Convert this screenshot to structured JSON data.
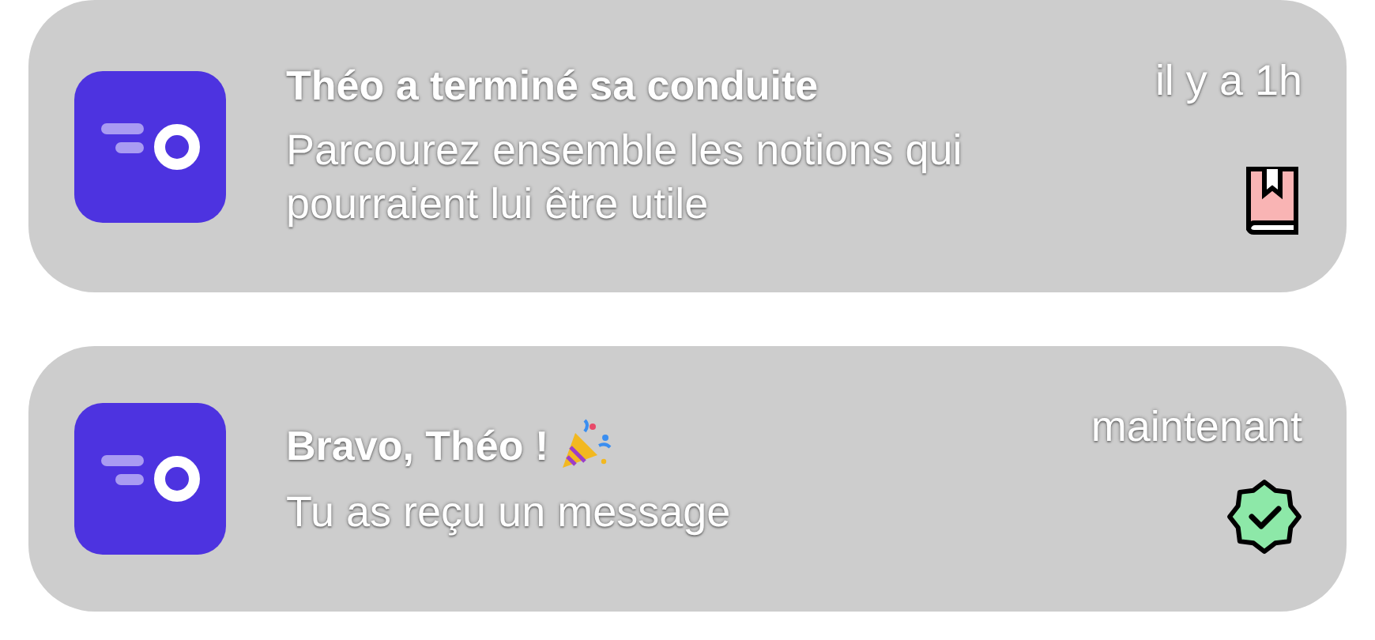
{
  "notifications": [
    {
      "title": "Théo a terminé sa conduite",
      "party_icon": false,
      "time": "il y a 1h",
      "body": "Parcourez ensemble les notions qui pourraient lui être utile",
      "kind": "book"
    },
    {
      "title": "Bravo, Théo !",
      "party_icon": true,
      "time": "maintenant",
      "body": "Tu as reçu un message",
      "kind": "badge"
    }
  ]
}
